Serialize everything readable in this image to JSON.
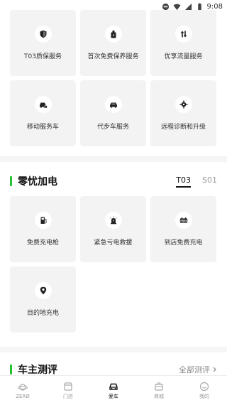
{
  "status_bar": {
    "time": "9:08",
    "icons": [
      "minus-circle-icon",
      "wifi-icon",
      "signal-icon",
      "battery-icon"
    ]
  },
  "services": [
    {
      "label": "T03质保服务",
      "icon": "shield-icon"
    },
    {
      "label": "首次免费保养服务",
      "icon": "oil-can-icon"
    },
    {
      "label": "优享流量服务",
      "icon": "updown-arrows-icon"
    },
    {
      "label": "移动服务车",
      "icon": "service-car-icon"
    },
    {
      "label": "代步车服务",
      "icon": "car-icon"
    },
    {
      "label": "远程诊断和升级",
      "icon": "gear-target-icon"
    }
  ],
  "charging": {
    "title": "零忧加电",
    "tabs": [
      {
        "label": "T03",
        "active": true
      },
      {
        "label": "S01",
        "active": false
      }
    ],
    "items": [
      {
        "label": "免费充电枪",
        "icon": "charger-icon"
      },
      {
        "label": "紧急亏电救援",
        "icon": "beacon-icon"
      },
      {
        "label": "到店免费充电",
        "icon": "free-battery-icon"
      },
      {
        "label": "目的地充电",
        "icon": "location-pin-icon"
      }
    ]
  },
  "reviews": {
    "title": "车主测评",
    "see_all": "全部测评"
  },
  "bottom_nav": [
    {
      "label": "ZERØ",
      "icon": "planet-icon",
      "active": false
    },
    {
      "label": "门店",
      "icon": "store-icon",
      "active": false
    },
    {
      "label": "爱车",
      "icon": "car-front-icon",
      "active": true
    },
    {
      "label": "商城",
      "icon": "shop-bag-icon",
      "active": false
    },
    {
      "label": "我的",
      "icon": "smile-icon",
      "active": false
    }
  ],
  "colors": {
    "accent": "#22c32e",
    "tile_bg": "#f3f3f3",
    "divider": "#f5f5f5"
  }
}
